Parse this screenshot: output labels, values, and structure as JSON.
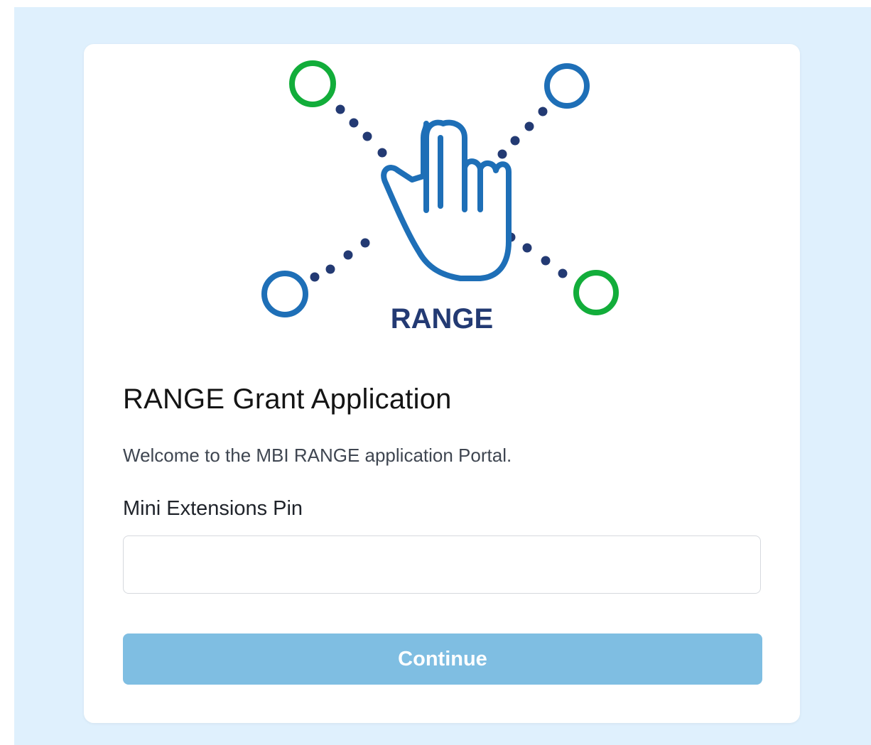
{
  "logo": {
    "wordmark": "RANGE",
    "icon": "hand-pointer-network-icon",
    "colors": {
      "green": "#12ad3a",
      "blue": "#1e6fb7",
      "navy": "#233a73"
    }
  },
  "form": {
    "title": "RANGE Grant Application",
    "welcome": "Welcome to the MBI RANGE application Portal.",
    "pin_label": "Mini Extensions Pin",
    "pin_value": "",
    "continue_label": "Continue"
  },
  "theme": {
    "page_background": "#dff0fd",
    "button_color": "#7fbee2"
  }
}
